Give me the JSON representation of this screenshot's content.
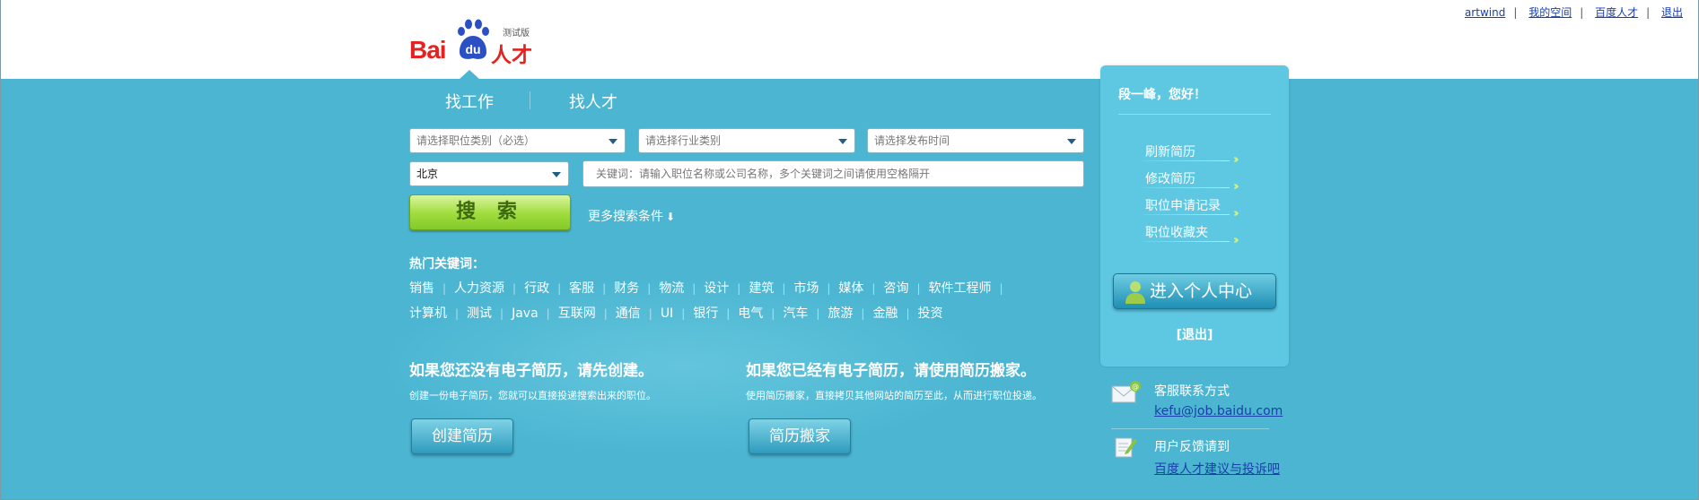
{
  "top_links": [
    "artwind",
    "我的空间",
    "百度人才",
    "退出"
  ],
  "logo": {
    "bai": "Bai",
    "du": "du",
    "rencai": "人才",
    "beta": "测试版"
  },
  "tabs": [
    "找工作",
    "找人才"
  ],
  "search": {
    "job_category": "请选择职位类别（必选）",
    "industry": "请选择行业类别",
    "publish_time": "请选择发布时间",
    "city": "北京",
    "keyword_placeholder": "关键词：请输入职位名称或公司名称，多个关键词之间请使用空格隔开",
    "search_label": "搜 索",
    "more_conditions": "更多搜索条件"
  },
  "hot_keywords": {
    "label": "热门关键词：",
    "row1": [
      "销售",
      "人力资源",
      "行政",
      "客服",
      "财务",
      "物流",
      "设计",
      "建筑",
      "市场",
      "媒体",
      "咨询",
      "软件工程师"
    ],
    "row2": [
      "计算机",
      "测试",
      "Java",
      "互联网",
      "通信",
      "UI",
      "银行",
      "电气",
      "汽车",
      "旅游",
      "金融",
      "投资"
    ]
  },
  "promo": {
    "create": {
      "title": "如果您还没有电子简历，请先创建。",
      "desc": "创建一份电子简历，您就可以直接投递搜索出来的职位。",
      "button": "创建简历"
    },
    "move": {
      "title": "如果您已经有电子简历，请使用简历搬家。",
      "desc": "使用简历搬家，直接拷贝其他网站的简历至此，从而进行职位投递。",
      "button": "简历搬家"
    }
  },
  "user_panel": {
    "greeting": "段一峰，您好！",
    "links": [
      "刷新简历",
      "修改简历",
      "职位申请记录",
      "职位收藏夹"
    ],
    "center_button": "进入个人中心",
    "logout": "[退出]"
  },
  "contact": {
    "service_title": "客服联系方式",
    "service_email": "kefu@job.baidu.com",
    "feedback_title": "用户反馈请到",
    "feedback_link": "百度人才建议与投诉吧"
  },
  "colors": {
    "band": "#4cb6d2",
    "panel": "#5ec8e2",
    "logo_red": "#e42221",
    "search_green": "#9fdc3c",
    "link_blue": "#1a3fa8"
  }
}
